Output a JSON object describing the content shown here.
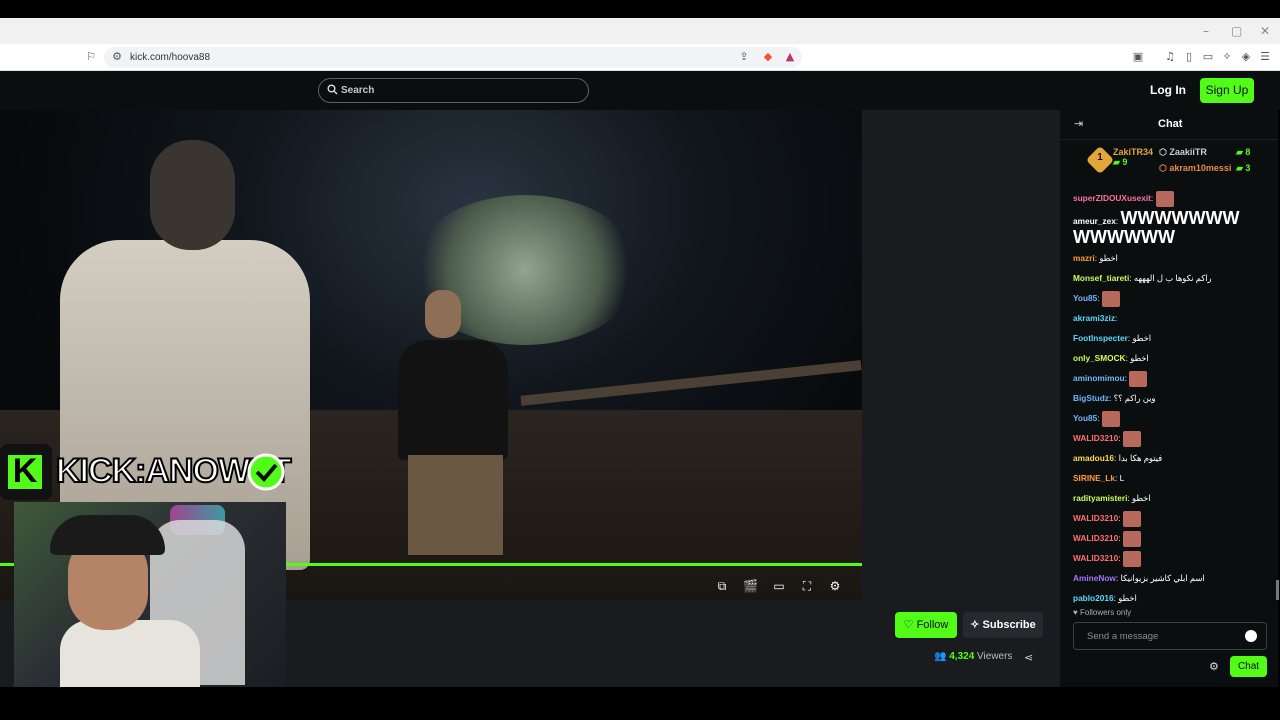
{
  "browser": {
    "url": "kick.com/hoova88",
    "window_controls": [
      "–",
      "▢",
      "✕"
    ]
  },
  "header": {
    "search_placeholder": "Search",
    "login_label": "Log In",
    "signup_label": "Sign Up"
  },
  "overlay": {
    "kick_letter": "K",
    "kick_text": "KICK:ANOWYT"
  },
  "stream": {
    "follow_label": "Follow",
    "subscribe_label": "Subscribe",
    "viewers_count": "4,324",
    "viewers_label": "Viewers",
    "progress": 1.0
  },
  "chat": {
    "title": "Chat",
    "leaderboard": {
      "first": {
        "rank": "1",
        "user": "ZakiTR34",
        "gifts": "9"
      },
      "second": {
        "user": "ZaakiiTR",
        "gifts": "8"
      },
      "third": {
        "user": "akram10messi",
        "gifts": "3"
      }
    },
    "messages": [
      {
        "user": "superZIDOUXusexit",
        "color": "#ff6fa8",
        "text": "",
        "emotes": 1
      },
      {
        "user": "ameur_zex",
        "color": "#ffffff",
        "text": "WWWWWWW WWWWWW",
        "emotes": 0,
        "big": true
      },
      {
        "user": "mazri",
        "color": "#ff9a3c",
        "text": "اخطو",
        "emotes": 0
      },
      {
        "user": "Monsef_tiareti",
        "color": "#c8ff5a",
        "text": "راكم نكوها ب ل الهههه",
        "emotes": 0
      },
      {
        "user": "You85",
        "color": "#6fb6ff",
        "text": "",
        "emotes": 1
      },
      {
        "user": "akrami3ziz",
        "color": "#5ad8ff",
        "text": "",
        "emotes": 0
      },
      {
        "user": "FootInspecter",
        "color": "#5ad8ff",
        "text": "اخطو",
        "emotes": 0
      },
      {
        "user": "only_SMOCK",
        "color": "#c8ff5a",
        "text": "اخطو",
        "emotes": 0
      },
      {
        "user": "aminomimou",
        "color": "#6fb6ff",
        "text": "",
        "emotes": 1
      },
      {
        "user": "BigStudz",
        "color": "#6fb6ff",
        "text": "وين راكم ؟؟",
        "emotes": 0
      },
      {
        "user": "You85",
        "color": "#6fb6ff",
        "text": "",
        "emotes": 1
      },
      {
        "user": "WALID3210",
        "color": "#ff6f6f",
        "text": "",
        "emotes": 1
      },
      {
        "user": "amadou16",
        "color": "#ffd84a",
        "text": "فيتوم هكا بدا",
        "emotes": 0
      },
      {
        "user": "SIRINE_Lk",
        "color": "#ff9a3c",
        "text": "L",
        "emotes": 0
      },
      {
        "user": "radityamisteri",
        "color": "#c8ff5a",
        "text": "اخطو",
        "emotes": 0
      },
      {
        "user": "WALID3210",
        "color": "#ff6f6f",
        "text": "",
        "emotes": 1
      },
      {
        "user": "WALID3210",
        "color": "#ff6f6f",
        "text": "",
        "emotes": 1
      },
      {
        "user": "WALID3210",
        "color": "#ff6f6f",
        "text": "",
        "emotes": 1
      },
      {
        "user": "AmineNow",
        "color": "#a86fff",
        "text": "اسم ابلي كاشير بزيوانيكا",
        "emotes": 0
      },
      {
        "user": "pablo2016",
        "color": "#5ad8ff",
        "text": "اخطو",
        "emotes": 0
      }
    ],
    "followers_only": "Followers only",
    "send_placeholder": "Send a message",
    "send_label": "Chat"
  },
  "colors": {
    "accent": "#53fc18",
    "background": "#0b0e0f",
    "panel": "#191b1f"
  }
}
